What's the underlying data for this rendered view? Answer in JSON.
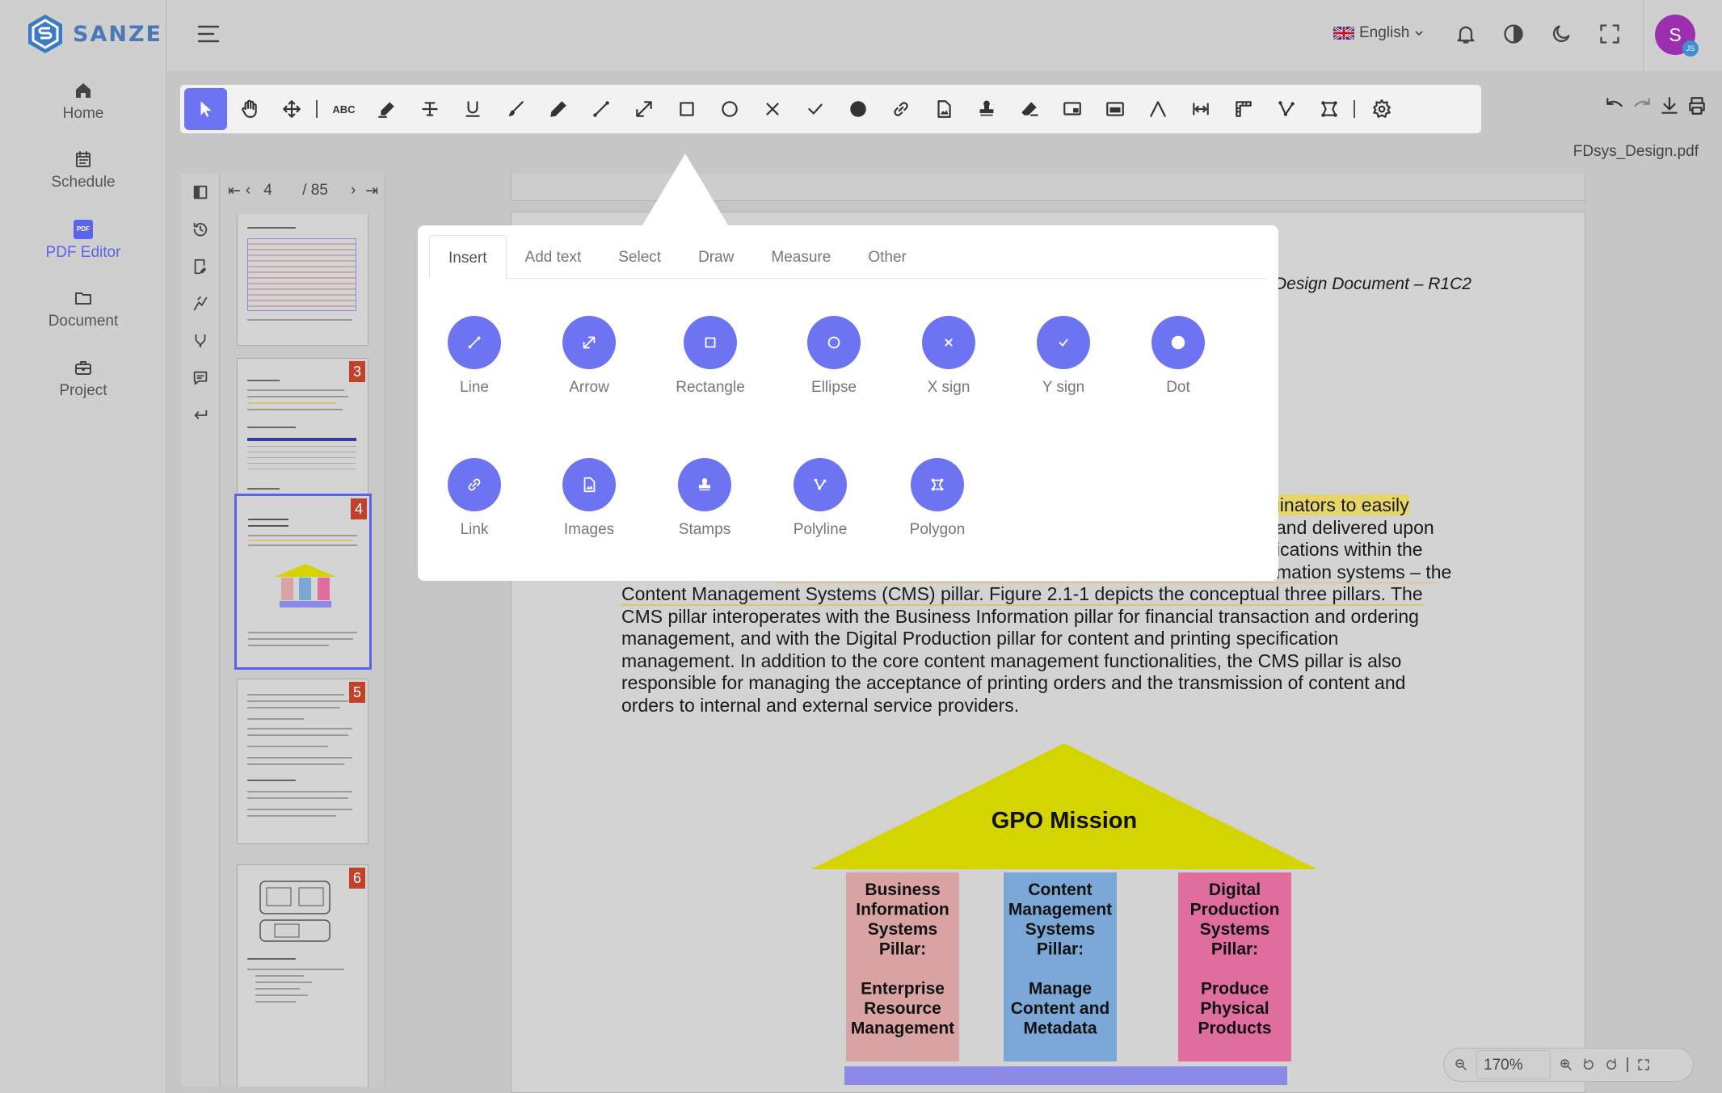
{
  "app": {
    "name": "SANZE"
  },
  "sidebar": {
    "items": [
      {
        "label": "Home",
        "icon": "home-icon"
      },
      {
        "label": "Schedule",
        "icon": "calendar-icon"
      },
      {
        "label": "PDF Editor",
        "icon": "pdf-icon",
        "active": true
      },
      {
        "label": "Document",
        "icon": "folder-icon"
      },
      {
        "label": "Project",
        "icon": "briefcase-icon"
      }
    ],
    "pdf_badge": "PDF"
  },
  "topbar": {
    "language": "English",
    "avatar_initial": "S",
    "avatar_sub": "JS"
  },
  "toolbar": {
    "text_tool_label": "ABC"
  },
  "file": {
    "name": "FDsys_Design.pdf"
  },
  "pager": {
    "current": "4",
    "total": "/ 85"
  },
  "thumbnails": [
    {
      "badge": "3"
    },
    {
      "badge": "4"
    },
    {
      "badge": "5"
    },
    {
      "badge": "6"
    }
  ],
  "document": {
    "header_title": "Design Document – R1C2",
    "lines": [
      "ginators to easily",
      "and delivered upon",
      "ications within the",
      "mation systems – the",
      "Content Management Systems (CMS) pillar. Figure 2.1-1 depicts the conceptual three pillars. The",
      "CMS pillar interoperates with the Business Information pillar for financial transaction and ordering",
      "management, and with the Digital Production pillar for content and printing specification",
      "management. In addition to the core content management functionalities, the CMS pillar is also",
      "responsible for managing the acceptance of printing orders and the transmission of content and",
      "orders to internal and external service providers."
    ],
    "diagram": {
      "roof": "GPO Mission",
      "pillars": [
        {
          "lines": [
            "Business",
            "Information",
            "Systems",
            "Pillar:",
            "",
            "Enterprise",
            "Resource",
            "Management"
          ],
          "color": "#d9a3a3"
        },
        {
          "lines": [
            "Content",
            "Management",
            "Systems",
            "Pillar:",
            "",
            "Manage",
            "Content and",
            "Metadata"
          ],
          "color": "#7ba7d6"
        },
        {
          "lines": [
            "Digital",
            "Production",
            "Systems",
            "Pillar:",
            "",
            "Produce",
            "Physical",
            "Products"
          ],
          "color": "#df6e9f"
        }
      ],
      "roof_color": "#d4d400",
      "base_color": "#8a8ae6"
    }
  },
  "popover": {
    "tabs": [
      "Insert",
      "Add text",
      "Select",
      "Draw",
      "Measure",
      "Other"
    ],
    "active_tab": "Insert",
    "tools": [
      {
        "label": "Line",
        "icon": "line-icon"
      },
      {
        "label": "Arrow",
        "icon": "arrow-icon"
      },
      {
        "label": "Rectangle",
        "icon": "rectangle-icon"
      },
      {
        "label": "Ellipse",
        "icon": "ellipse-icon"
      },
      {
        "label": "X sign",
        "icon": "x-sign-icon"
      },
      {
        "label": "Y sign",
        "icon": "check-icon"
      },
      {
        "label": "Dot",
        "icon": "dot-icon"
      },
      {
        "label": "Link",
        "icon": "link-icon"
      },
      {
        "label": "Images",
        "icon": "image-icon"
      },
      {
        "label": "Stamps",
        "icon": "stamp-icon"
      },
      {
        "label": "Polyline",
        "icon": "polyline-icon"
      },
      {
        "label": "Polygon",
        "icon": "polygon-icon"
      }
    ]
  },
  "zoom": {
    "value": "170%"
  },
  "colors": {
    "accent": "#6d74f2",
    "highlight": "#e6d66a",
    "badge": "#c2412a"
  }
}
